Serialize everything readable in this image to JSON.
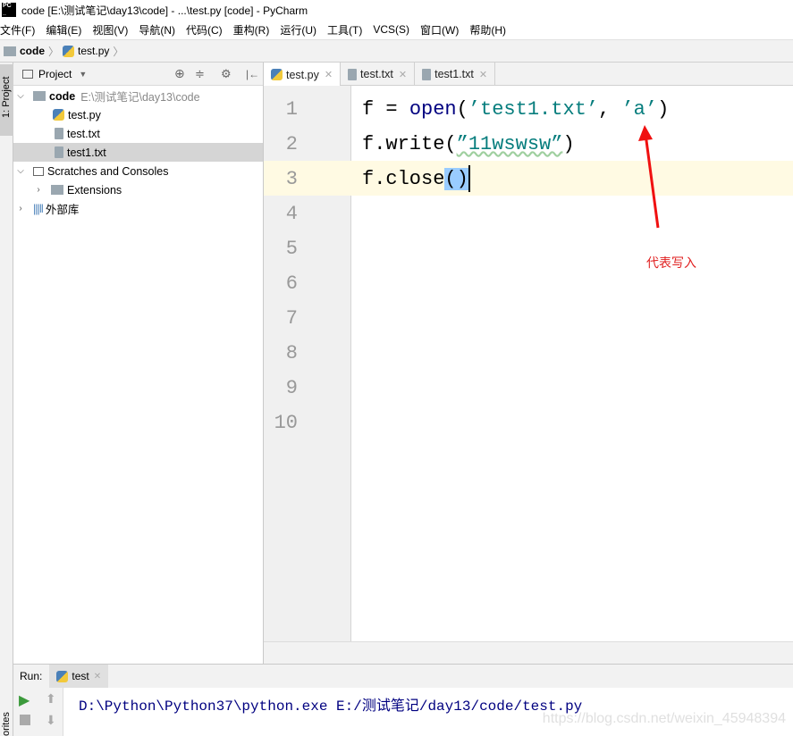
{
  "window": {
    "title": "code [E:\\测试笔记\\day13\\code] - ...\\test.py [code] - PyCharm",
    "logo": "PC"
  },
  "menu": [
    "文件(F)",
    "编辑(E)",
    "视图(V)",
    "导航(N)",
    "代码(C)",
    "重构(R)",
    "运行(U)",
    "工具(T)",
    "VCS(S)",
    "窗口(W)",
    "帮助(H)"
  ],
  "breadcrumb": {
    "folder": "code",
    "file": "test.py"
  },
  "left_strip": {
    "project_tab": "1: Project",
    "favorites_tab": "orites"
  },
  "project": {
    "title": "Project",
    "tree": [
      {
        "label": "code",
        "path": "E:\\测试笔记\\day13\\code",
        "icon": "folder-icon",
        "expanded": true
      },
      {
        "label": "test.py",
        "icon": "python-file-icon"
      },
      {
        "label": "test.txt",
        "icon": "text-file-icon"
      },
      {
        "label": "test1.txt",
        "icon": "text-file-icon",
        "selected": true
      },
      {
        "label": "Scratches and Consoles",
        "icon": "scratches-icon",
        "expanded": true
      },
      {
        "label": "Extensions",
        "icon": "folder-icon"
      },
      {
        "label": "外部库",
        "icon": "library-icon"
      }
    ]
  },
  "tabs": [
    {
      "label": "test.py",
      "active": true
    },
    {
      "label": "test.txt"
    },
    {
      "label": "test1.txt"
    }
  ],
  "editor": {
    "line_numbers": [
      "1",
      "2",
      "3",
      "4",
      "5",
      "6",
      "7",
      "8",
      "9",
      "10"
    ],
    "line1": {
      "a": "f = ",
      "b": "open",
      "c": "(",
      "d": "’test1.txt’",
      "e": ", ",
      "f": "’a’",
      "g": ")"
    },
    "line2": {
      "a": "f.write(",
      "b": "”11wswsw”",
      "c": ")"
    },
    "line3": {
      "a": "f.close",
      "b": "()"
    },
    "annotation": "代表写入"
  },
  "run": {
    "label": "Run:",
    "tab": "test",
    "command": "D:\\Python\\Python37\\python.exe E:/测试笔记/day13/code/test.py"
  },
  "watermark": "https://blog.csdn.net/weixin_45948394"
}
